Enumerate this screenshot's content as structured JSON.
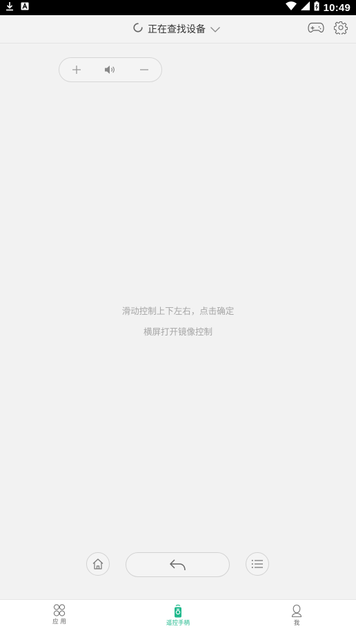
{
  "status_bar": {
    "time": "10:49"
  },
  "header": {
    "device_status": "正在查找设备"
  },
  "hints": {
    "line1": "滑动控制上下左右，点击确定",
    "line2": "横屏打开镜像控制"
  },
  "bottom_nav": {
    "items": [
      {
        "label": "应 用",
        "icon": "apps-icon"
      },
      {
        "label": "遥控手柄",
        "icon": "remote-icon",
        "active": true
      },
      {
        "label": "我",
        "icon": "user-icon"
      }
    ]
  },
  "colors": {
    "accent": "#21b98d",
    "background": "#f2f2f2"
  }
}
